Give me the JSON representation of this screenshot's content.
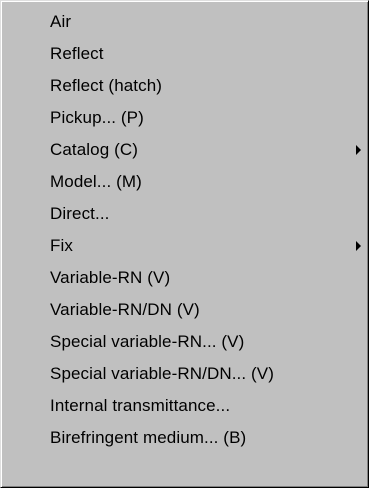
{
  "menu": {
    "items": [
      {
        "label": "Air",
        "submenu": false
      },
      {
        "label": "Reflect",
        "submenu": false
      },
      {
        "label": "Reflect (hatch)",
        "submenu": false
      },
      {
        "label": "Pickup... (P)",
        "submenu": false
      },
      {
        "label": "Catalog (C)",
        "submenu": true,
        "arrow_icon": "submenu-arrow-icon"
      },
      {
        "label": "Model... (M)",
        "submenu": false
      },
      {
        "label": "Direct...",
        "submenu": false
      },
      {
        "label": "Fix",
        "submenu": true,
        "arrow_icon": "submenu-arrow-icon"
      },
      {
        "label": "Variable-RN (V)",
        "submenu": false
      },
      {
        "label": "Variable-RN/DN (V)",
        "submenu": false
      },
      {
        "label": "Special variable-RN... (V)",
        "submenu": false
      },
      {
        "label": "Special variable-RN/DN... (V)",
        "submenu": false
      },
      {
        "label": "Internal transmittance...",
        "submenu": false
      },
      {
        "label": "Birefringent medium... (B)",
        "submenu": false
      }
    ]
  },
  "colors": {
    "menu_background": "#c0c0c0",
    "text": "#000000"
  }
}
